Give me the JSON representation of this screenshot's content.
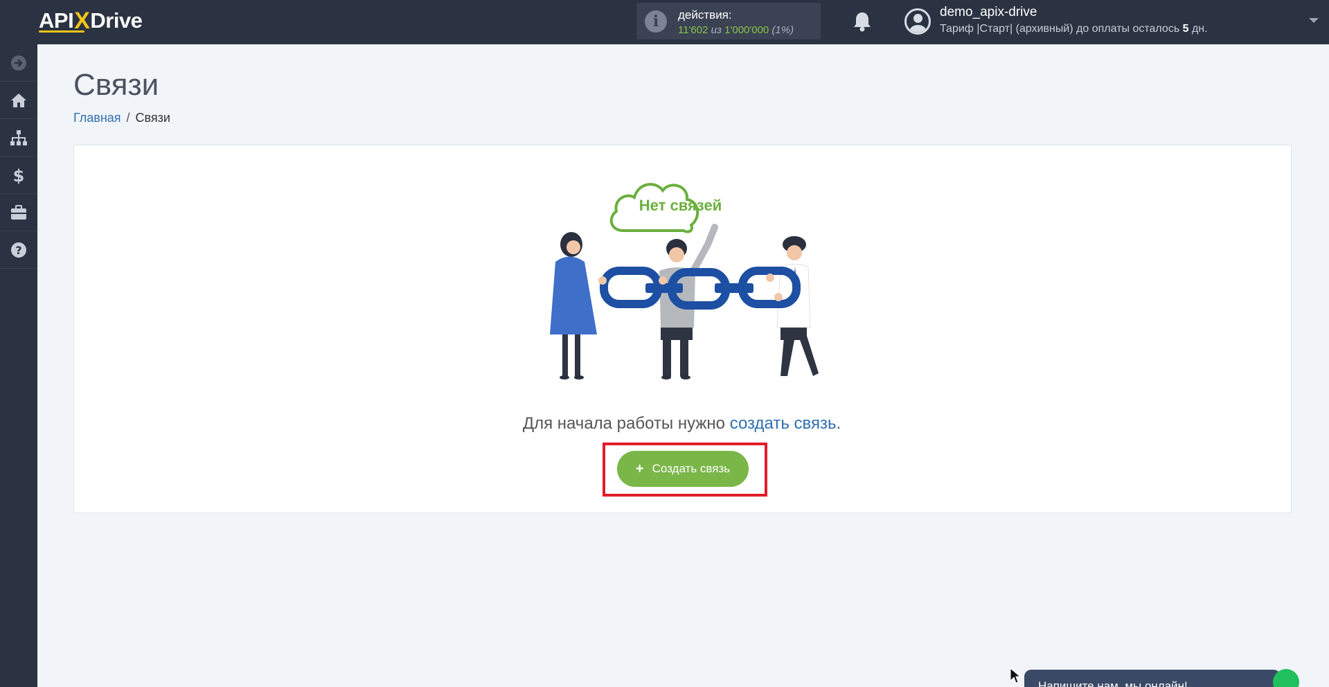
{
  "header": {
    "logo": {
      "prefix": "API",
      "x": "X",
      "suffix": "Drive"
    },
    "actions": {
      "label": "действия:",
      "used": "11'602",
      "separator": "из",
      "total": "1'000'000",
      "percent": "(1%)"
    },
    "user": {
      "name": "demo_apix-drive",
      "tariff_prefix": "Тариф |Старт| (архивный) до оплаты осталось",
      "tariff_days": "5",
      "tariff_suffix": "дн."
    }
  },
  "sidebar": {
    "items": [
      {
        "icon": "arrow-right-circle-icon"
      },
      {
        "icon": "home-icon"
      },
      {
        "icon": "sitemap-icon"
      },
      {
        "icon": "dollar-icon"
      },
      {
        "icon": "briefcase-icon"
      },
      {
        "icon": "question-circle-icon"
      }
    ]
  },
  "page": {
    "title": "Связи",
    "breadcrumb": {
      "home": "Главная",
      "separator": "/",
      "current": "Связи"
    }
  },
  "empty_state": {
    "cloud_text": "Нет связей",
    "hint_prefix": "Для начала работы нужно",
    "hint_link": "создать связь",
    "hint_suffix": ".",
    "button_label": "Создать связь",
    "button_icon": "plus-icon"
  },
  "chat": {
    "text": "Напишите нам, мы онлайн!"
  },
  "colors": {
    "topbar": "#2b3342",
    "accent_green": "#7ab648",
    "link_blue": "#2f6fb0",
    "highlight_red": "#e11d2a"
  }
}
